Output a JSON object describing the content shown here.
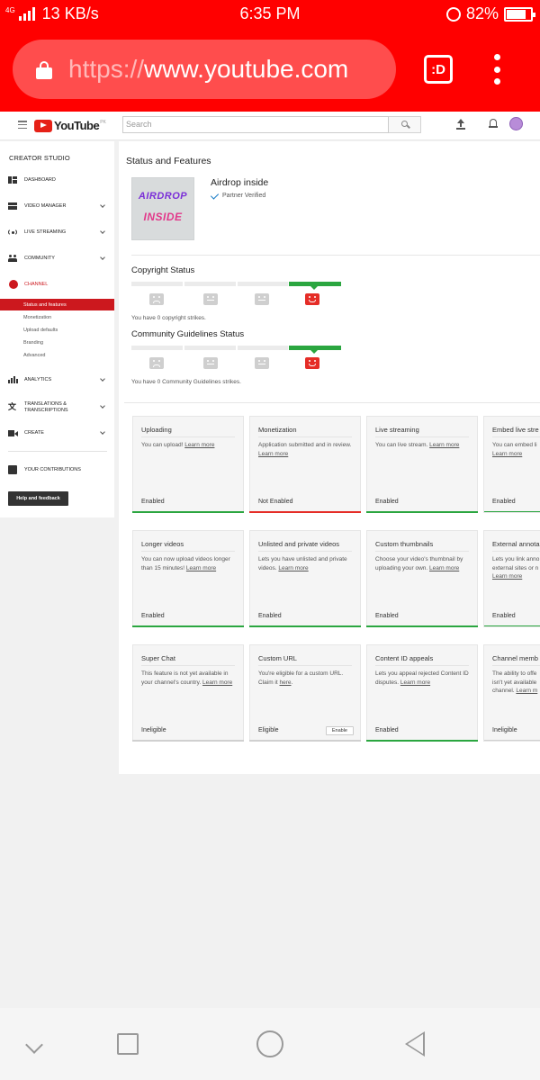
{
  "status_bar": {
    "network": "4G",
    "speed": "13 KB/s",
    "time": "6:35 PM",
    "battery": "82%",
    "battery_level": 0.82
  },
  "browser": {
    "url_scheme": "https://",
    "url_host": "www.youtube.com",
    "tab_button": ":D"
  },
  "yt_header": {
    "logo": "YouTube",
    "country": "PK",
    "search_placeholder": "Search"
  },
  "sidebar": {
    "heading": "CREATOR STUDIO",
    "items": [
      {
        "label": "DASHBOARD",
        "icon": "dashboard-icon"
      },
      {
        "label": "VIDEO MANAGER",
        "icon": "video-manager-icon"
      },
      {
        "label": "LIVE STREAMING",
        "icon": "live-streaming-icon"
      },
      {
        "label": "COMMUNITY",
        "icon": "community-icon"
      },
      {
        "label": "CHANNEL",
        "icon": "channel-icon"
      }
    ],
    "channel_sub": [
      "Status and features",
      "Monetization",
      "Upload defaults",
      "Branding",
      "Advanced"
    ],
    "items2": [
      {
        "label": "ANALYTICS",
        "icon": "analytics-icon"
      },
      {
        "label": "TRANSLATIONS &",
        "label2": "TRANSCRIPTIONS",
        "icon": "translate-icon"
      },
      {
        "label": "CREATE",
        "icon": "create-icon"
      }
    ],
    "contributions": "YOUR CONTRIBUTIONS",
    "help": "Help and feedback"
  },
  "main": {
    "title": "Status and Features",
    "thumbnail_line1": "AIRDROP",
    "thumbnail_line2": "INSIDE",
    "channel_name": "Airdrop inside",
    "verified": "Partner Verified",
    "copyright_title": "Copyright Status",
    "copyright_text": "You have 0 copyright strikes.",
    "community_title": "Community Guidelines Status",
    "community_text": "You have 0 Community Guidelines strikes."
  },
  "features": [
    {
      "title": "Uploading",
      "desc": "You can upload!",
      "link": "Learn more",
      "status": "Enabled",
      "bar": "green"
    },
    {
      "title": "Monetization",
      "desc": "Application submitted and in review.",
      "link": "Learn more",
      "status": "Not Enabled",
      "bar": "red"
    },
    {
      "title": "Live streaming",
      "desc": "You can live stream.",
      "link": "Learn more",
      "status": "Enabled",
      "bar": "green"
    },
    {
      "title": "Embed live stre",
      "desc": "You can embed li",
      "link": "Learn more",
      "status": "Enabled",
      "bar": "green"
    },
    {
      "title": "Longer videos",
      "desc": "You can now upload videos longer than 15 minutes!",
      "link": "Learn more",
      "status": "Enabled",
      "bar": "green"
    },
    {
      "title": "Unlisted and private videos",
      "desc": "Lets you have unlisted and private videos.",
      "link": "Learn more",
      "status": "Enabled",
      "bar": "green"
    },
    {
      "title": "Custom thumbnails",
      "desc": "Choose your video's thumbnail by uploading your own.",
      "link": "Learn more",
      "status": "Enabled",
      "bar": "green"
    },
    {
      "title": "External annota",
      "desc": "Lets you link anno external sites or n",
      "link": "Learn more",
      "status": "Enabled",
      "bar": "green"
    },
    {
      "title": "Super Chat",
      "desc": "This feature is not yet available in your channel's country.",
      "link": "Learn more",
      "status": "Ineligible",
      "bar": "gray"
    },
    {
      "title": "Custom URL",
      "desc": "You're eligible for a custom URL. Claim it",
      "link": "here",
      "status": "Eligible",
      "bar": "gray",
      "button": "Enable"
    },
    {
      "title": "Content ID appeals",
      "desc": "Lets you appeal rejected Content ID disputes.",
      "link": "Learn more",
      "status": "Enabled",
      "bar": "green"
    },
    {
      "title": "Channel memb",
      "desc": "The ability to offe isn't yet available channel.",
      "link": "Learn m",
      "status": "Ineligible",
      "bar": "gray"
    }
  ]
}
